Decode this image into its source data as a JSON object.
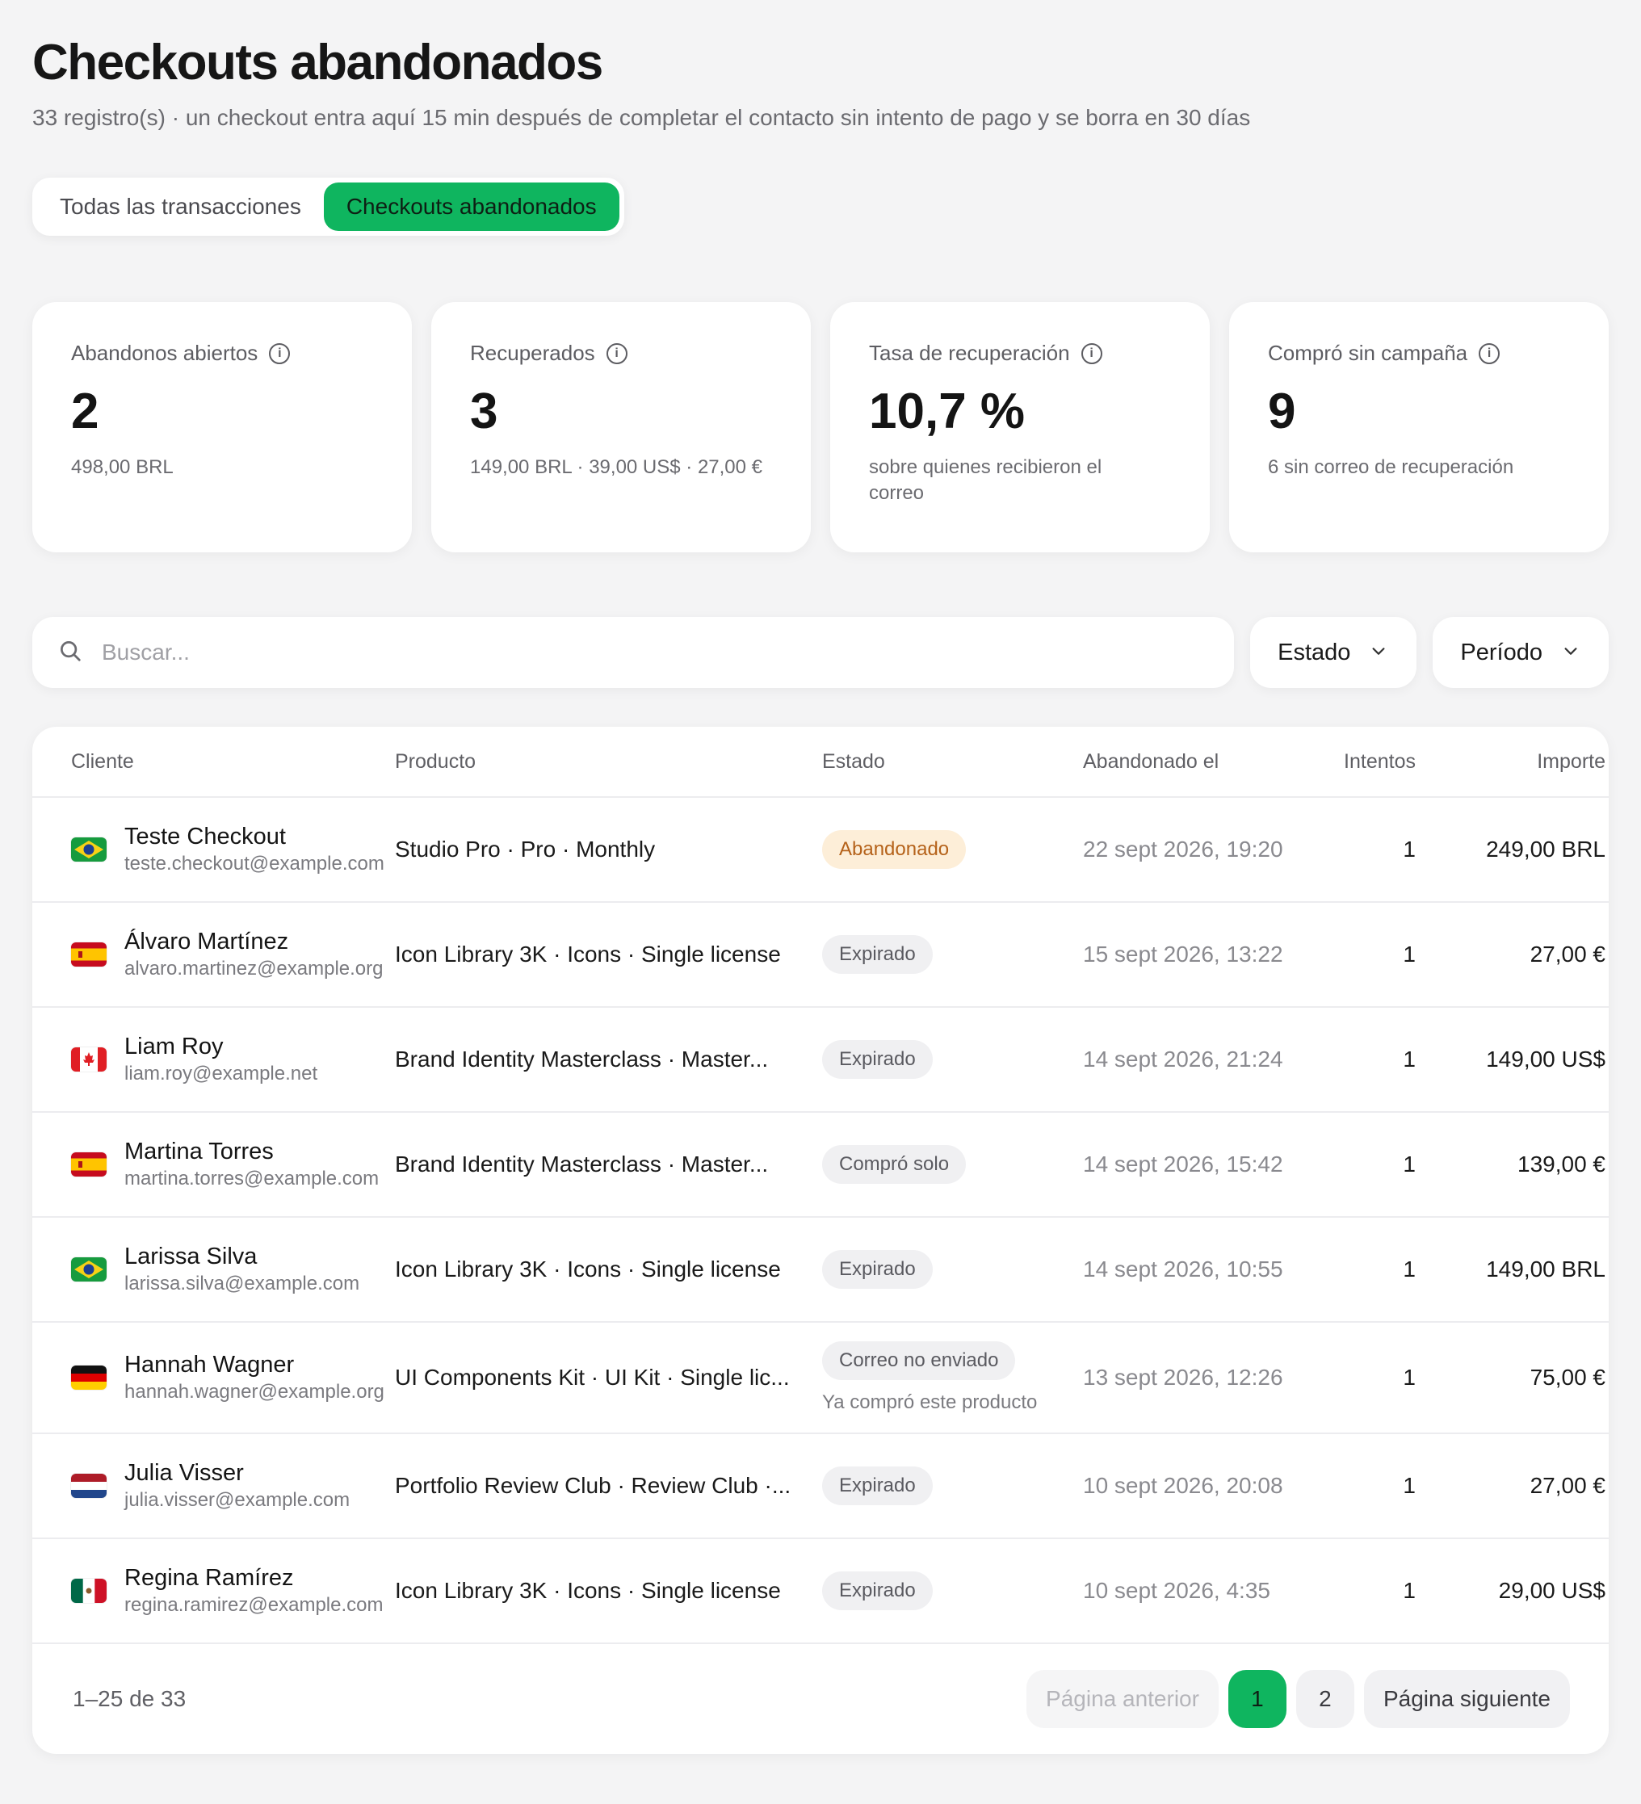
{
  "header": {
    "title": "Checkouts abandonados",
    "subtitle": "33 registro(s) · un checkout entra aquí 15 min después de completar el contacto sin intento de pago y se borra en 30 días"
  },
  "tabs": [
    {
      "label": "Todas las transacciones",
      "active": false
    },
    {
      "label": "Checkouts abandonados",
      "active": true
    }
  ],
  "stats": [
    {
      "label": "Abandonos abiertos",
      "value": "2",
      "sub": "498,00 BRL"
    },
    {
      "label": "Recuperados",
      "value": "3",
      "sub": "149,00 BRL · 39,00 US$ · 27,00 €"
    },
    {
      "label": "Tasa de recuperación",
      "value": "10,7 %",
      "sub": "sobre quienes recibieron el correo"
    },
    {
      "label": "Compró sin campaña",
      "value": "9",
      "sub": "6 sin correo de recuperación"
    }
  ],
  "filters": {
    "search_placeholder": "Buscar...",
    "status_label": "Estado",
    "period_label": "Período"
  },
  "table": {
    "columns": {
      "client": "Cliente",
      "product": "Producto",
      "status": "Estado",
      "date": "Abandonado el",
      "attempts": "Intentos",
      "amount": "Importe"
    },
    "rows": [
      {
        "flag": "BR",
        "name": "Teste Checkout",
        "email": "teste.checkout@example.com",
        "product": "Studio Pro · Pro · Monthly",
        "status": "Abandonado",
        "status_tone": "orange",
        "note": "",
        "date": "22 sept 2026, 19:20",
        "attempts": "1",
        "amount": "249,00 BRL"
      },
      {
        "flag": "ES",
        "name": "Álvaro Martínez",
        "email": "alvaro.martinez@example.org",
        "product": "Icon Library 3K · Icons · Single license",
        "status": "Expirado",
        "status_tone": "gray",
        "note": "",
        "date": "15 sept 2026, 13:22",
        "attempts": "1",
        "amount": "27,00 €"
      },
      {
        "flag": "CA",
        "name": "Liam Roy",
        "email": "liam.roy@example.net",
        "product": "Brand Identity Masterclass · Master...",
        "status": "Expirado",
        "status_tone": "gray",
        "note": "",
        "date": "14 sept 2026, 21:24",
        "attempts": "1",
        "amount": "149,00 US$"
      },
      {
        "flag": "ES",
        "name": "Martina Torres",
        "email": "martina.torres@example.com",
        "product": "Brand Identity Masterclass · Master...",
        "status": "Compró solo",
        "status_tone": "gray",
        "note": "",
        "date": "14 sept 2026, 15:42",
        "attempts": "1",
        "amount": "139,00 €"
      },
      {
        "flag": "BR",
        "name": "Larissa Silva",
        "email": "larissa.silva@example.com",
        "product": "Icon Library 3K · Icons · Single license",
        "status": "Expirado",
        "status_tone": "gray",
        "note": "",
        "date": "14 sept 2026, 10:55",
        "attempts": "1",
        "amount": "149,00 BRL"
      },
      {
        "flag": "DE",
        "name": "Hannah Wagner",
        "email": "hannah.wagner@example.org",
        "product": "UI Components Kit · UI Kit · Single lic...",
        "status": "Correo no enviado",
        "status_tone": "gray",
        "note": "Ya compró este producto",
        "date": "13 sept 2026, 12:26",
        "attempts": "1",
        "amount": "75,00 €"
      },
      {
        "flag": "NL",
        "name": "Julia Visser",
        "email": "julia.visser@example.com",
        "product": "Portfolio Review Club · Review Club ·...",
        "status": "Expirado",
        "status_tone": "gray",
        "note": "",
        "date": "10 sept 2026, 20:08",
        "attempts": "1",
        "amount": "27,00 €"
      },
      {
        "flag": "MX",
        "name": "Regina Ramírez",
        "email": "regina.ramirez@example.com",
        "product": "Icon Library 3K · Icons · Single license",
        "status": "Expirado",
        "status_tone": "gray",
        "note": "",
        "date": "10 sept 2026, 4:35",
        "attempts": "1",
        "amount": "29,00 US$"
      }
    ]
  },
  "pagination": {
    "range": "1–25 de 33",
    "prev_label": "Página anterior",
    "pages": [
      "1",
      "2"
    ],
    "current_page": "1",
    "next_label": "Página siguiente"
  },
  "colors": {
    "accent": "#0fb55f",
    "badge_orange_bg": "#fdeed8",
    "badge_orange_text": "#b5621a",
    "badge_gray_bg": "#f0f0f2"
  }
}
